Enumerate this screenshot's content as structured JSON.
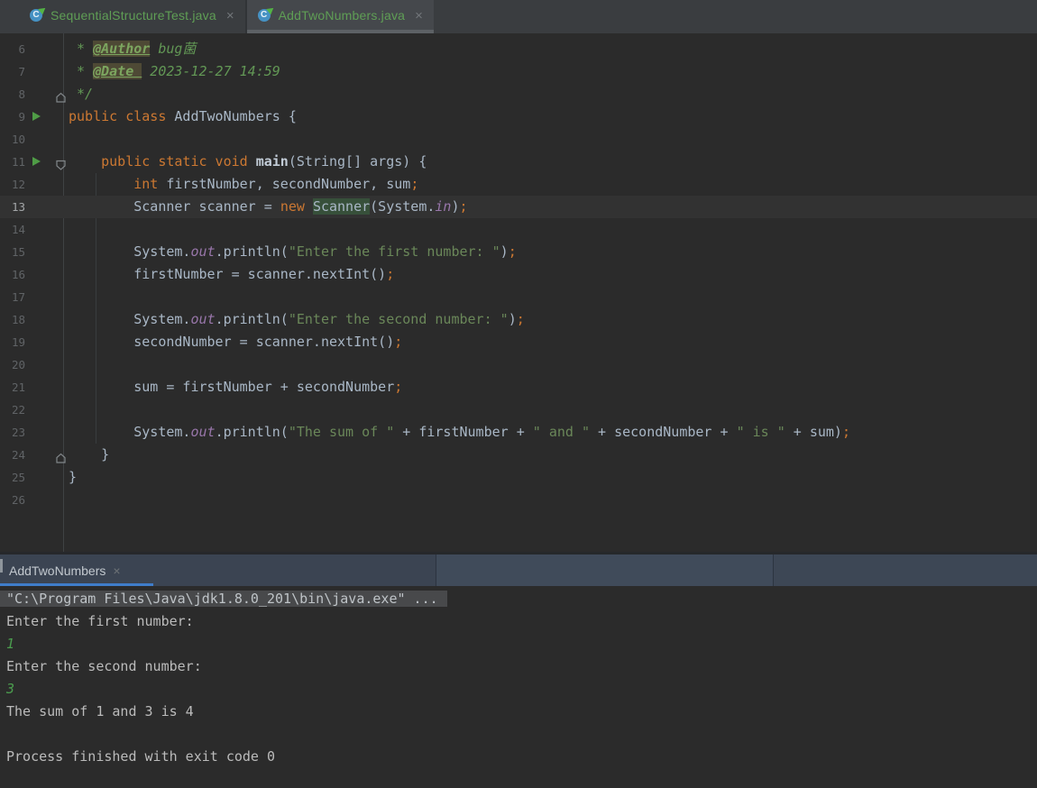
{
  "colors": {
    "editor_bg": "#2b2b2b",
    "caret_row_bg": "#323232",
    "keyword_orange": "#cc7832",
    "plain_text": "#a9b7c6",
    "string_green": "#6a8759",
    "comment_green": "#629755",
    "field_purple": "#9876aa",
    "tab_filename_green": "#5f9e55",
    "run_tab_underline_blue": "#3f7dca",
    "active_tab_underline_gray": "#5d6165",
    "console_input_green": "#4b9c4e",
    "usage_highlight_bg": "#37503a",
    "run_header_bg": "#3b4452"
  },
  "editor_tabs": {
    "tabs": [
      {
        "label": "SequentialStructureTest.java",
        "close": "×",
        "icon": "java-class-runnable",
        "active": false
      },
      {
        "label": "AddTwoNumbers.java",
        "close": "×",
        "icon": "java-class-runnable",
        "active": true
      }
    ]
  },
  "editor": {
    "lines": [
      {
        "n": "6",
        "t": [
          [
            "c",
            " * "
          ],
          [
            "g",
            "@Author"
          ],
          [
            "ci",
            " bug菌"
          ]
        ]
      },
      {
        "n": "7",
        "t": [
          [
            "c",
            " * "
          ],
          [
            "g",
            "@Date "
          ],
          [
            "ci",
            " 2023-12-27 14:59"
          ]
        ]
      },
      {
        "n": "8",
        "fold": "up",
        "t": [
          [
            "ci",
            " */"
          ]
        ]
      },
      {
        "n": "9",
        "run": true,
        "t": [
          [
            "k",
            "public class "
          ],
          [
            "p",
            "AddTwoNumbers {"
          ]
        ]
      },
      {
        "n": "10",
        "t": []
      },
      {
        "n": "11",
        "run": true,
        "fold": "down",
        "t": [
          [
            "p",
            "    "
          ],
          [
            "k",
            "public static void "
          ],
          [
            "m",
            "main"
          ],
          [
            "p",
            "(String[] args) {"
          ]
        ]
      },
      {
        "n": "12",
        "t": [
          [
            "p",
            "        "
          ],
          [
            "k",
            "int "
          ],
          [
            "p",
            "firstNumber, secondNumber, sum"
          ],
          [
            "k",
            ";"
          ]
        ]
      },
      {
        "n": "13",
        "hl": true,
        "t": [
          [
            "p",
            "        Scanner scanner = "
          ],
          [
            "k",
            "new "
          ],
          [
            "u",
            "Scanner"
          ],
          [
            "p",
            "(System."
          ],
          [
            "f",
            "in"
          ],
          [
            "p",
            ")"
          ],
          [
            "k",
            ";"
          ]
        ]
      },
      {
        "n": "14",
        "t": []
      },
      {
        "n": "15",
        "t": [
          [
            "p",
            "        System."
          ],
          [
            "f",
            "out"
          ],
          [
            "p",
            ".println("
          ],
          [
            "s",
            "\"Enter the first number: \""
          ],
          [
            "p",
            ")"
          ],
          [
            "k",
            ";"
          ]
        ]
      },
      {
        "n": "16",
        "t": [
          [
            "p",
            "        firstNumber = scanner.nextInt()"
          ],
          [
            "k",
            ";"
          ]
        ]
      },
      {
        "n": "17",
        "t": []
      },
      {
        "n": "18",
        "t": [
          [
            "p",
            "        System."
          ],
          [
            "f",
            "out"
          ],
          [
            "p",
            ".println("
          ],
          [
            "s",
            "\"Enter the second number: \""
          ],
          [
            "p",
            ")"
          ],
          [
            "k",
            ";"
          ]
        ]
      },
      {
        "n": "19",
        "t": [
          [
            "p",
            "        secondNumber = scanner.nextInt()"
          ],
          [
            "k",
            ";"
          ]
        ]
      },
      {
        "n": "20",
        "t": []
      },
      {
        "n": "21",
        "t": [
          [
            "p",
            "        sum = firstNumber + secondNumber"
          ],
          [
            "k",
            ";"
          ]
        ]
      },
      {
        "n": "22",
        "t": []
      },
      {
        "n": "23",
        "t": [
          [
            "p",
            "        System."
          ],
          [
            "f",
            "out"
          ],
          [
            "p",
            ".println("
          ],
          [
            "s",
            "\"The sum of \""
          ],
          [
            "p",
            " + firstNumber + "
          ],
          [
            "s",
            "\" and \""
          ],
          [
            "p",
            " + secondNumber + "
          ],
          [
            "s",
            "\" is \""
          ],
          [
            "p",
            " + sum)"
          ],
          [
            "k",
            ";"
          ]
        ]
      },
      {
        "n": "24",
        "fold": "up",
        "t": [
          [
            "p",
            "    }"
          ]
        ]
      },
      {
        "n": "25",
        "t": [
          [
            "p",
            "}"
          ]
        ]
      },
      {
        "n": "26",
        "t": []
      }
    ]
  },
  "run_panel": {
    "tab_label": "AddTwoNumbers",
    "tab_close": "×"
  },
  "console": {
    "lines": [
      {
        "cls": "sel",
        "text": "\"C:\\Program Files\\Java\\jdk1.8.0_201\\bin\\java.exe\" ..."
      },
      {
        "cls": "out",
        "text": "Enter the first number: "
      },
      {
        "cls": "in",
        "text": "1"
      },
      {
        "cls": "out",
        "text": "Enter the second number: "
      },
      {
        "cls": "in",
        "text": "3"
      },
      {
        "cls": "out",
        "text": "The sum of 1 and 3 is 4"
      },
      {
        "cls": "out",
        "text": ""
      },
      {
        "cls": "out",
        "text": "Process finished with exit code 0"
      }
    ]
  }
}
